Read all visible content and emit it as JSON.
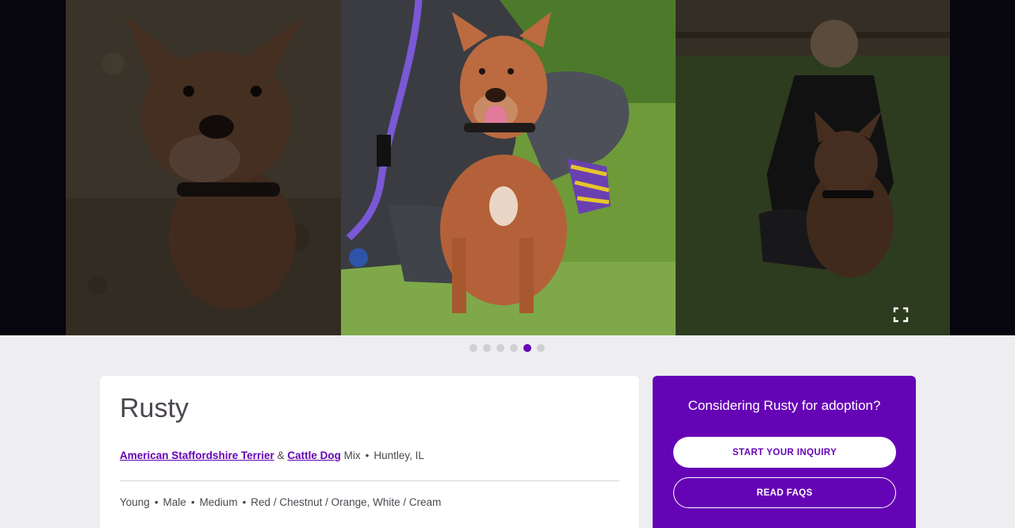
{
  "carousel": {
    "photos": [
      {
        "icon": "dog-photo-left",
        "state": "dimmed"
      },
      {
        "icon": "dog-photo-center",
        "state": "active"
      },
      {
        "icon": "dog-photo-right",
        "state": "dimmed"
      }
    ],
    "expand_icon": "expand-icon",
    "dot_count": 6,
    "active_dot_index": 4
  },
  "pet": {
    "name": "Rusty",
    "breed_primary": "American Staffordshire Terrier",
    "breed_connector": "&",
    "breed_secondary": "Cattle Dog",
    "breed_suffix": "Mix",
    "location": "Huntley, IL",
    "age": "Young",
    "sex": "Male",
    "size": "Medium",
    "colors": "Red / Chestnut / Orange, White / Cream",
    "separator": "•"
  },
  "adoption": {
    "title": "Considering Rusty for adoption?",
    "inquiry_label": "START YOUR INQUIRY",
    "faq_label": "READ FAQS"
  },
  "colors": {
    "brand_purple": "#6504b5",
    "text": "#4d4751",
    "background": "#eeeef0",
    "dot_inactive": "#cfd0d4"
  }
}
